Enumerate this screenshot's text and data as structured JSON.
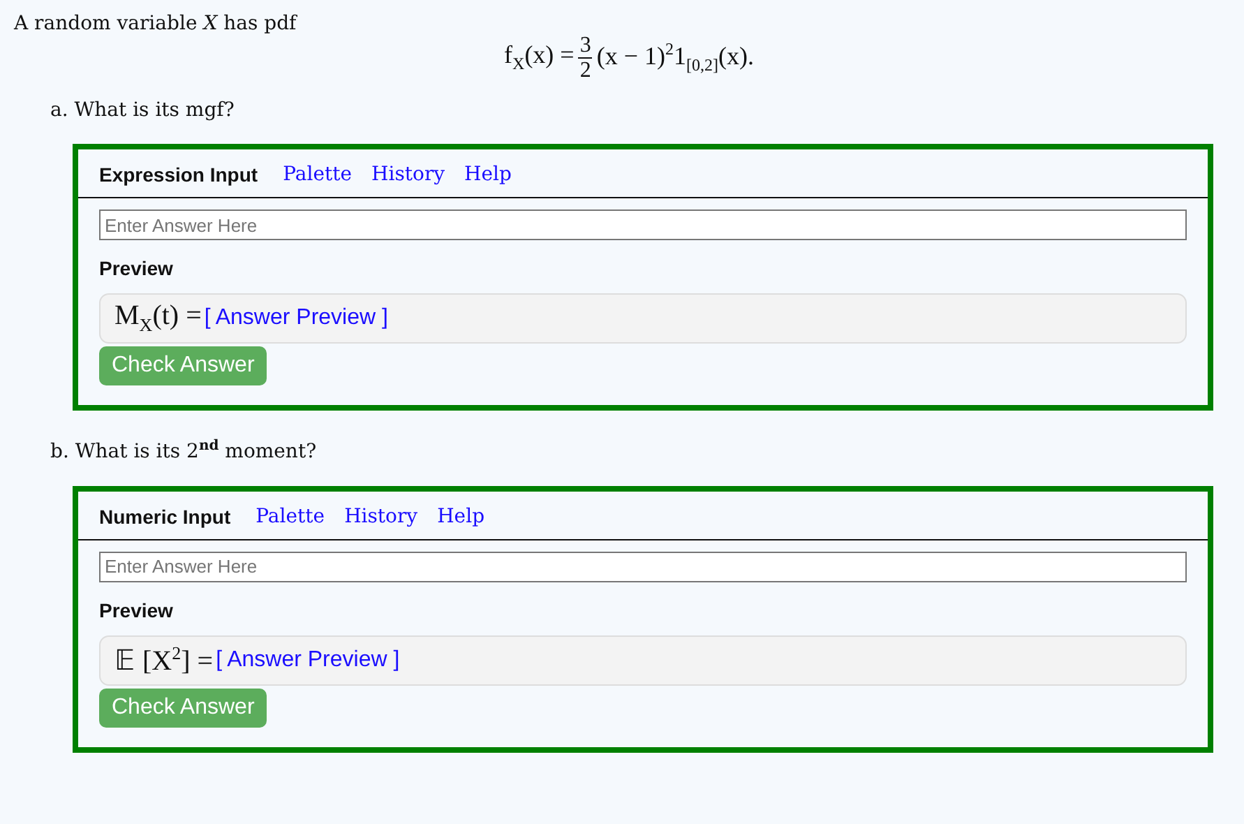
{
  "intro": "A random variable *X* has pdf",
  "formula": {
    "lhs": "f$_{X}$(x) =",
    "numerator": "3",
    "denominator": "2",
    "rest": "(x − 1)$^{2}$1$_{[0,2]}$(x)."
  },
  "parts": [
    {
      "question": "a. What is its mgf?",
      "input_kind": "Expression Input",
      "links": [
        "Palette",
        "History",
        "Help"
      ],
      "placeholder": "Enter Answer Here",
      "preview_label": "Preview",
      "preview_math": "M$_{X}$(t) =",
      "preview_text": "[ Answer Preview ]",
      "button": "Check Answer"
    },
    {
      "question": "b. What is its 2$^{nd}$ moment?",
      "input_kind": "Numeric Input",
      "links": [
        "Palette",
        "History",
        "Help"
      ],
      "placeholder": "Enter Answer Here",
      "preview_label": "Preview",
      "preview_math": "𝔼 [X$^{2}$] =",
      "preview_text": "[ Answer Preview ]",
      "button": "Check Answer"
    }
  ]
}
